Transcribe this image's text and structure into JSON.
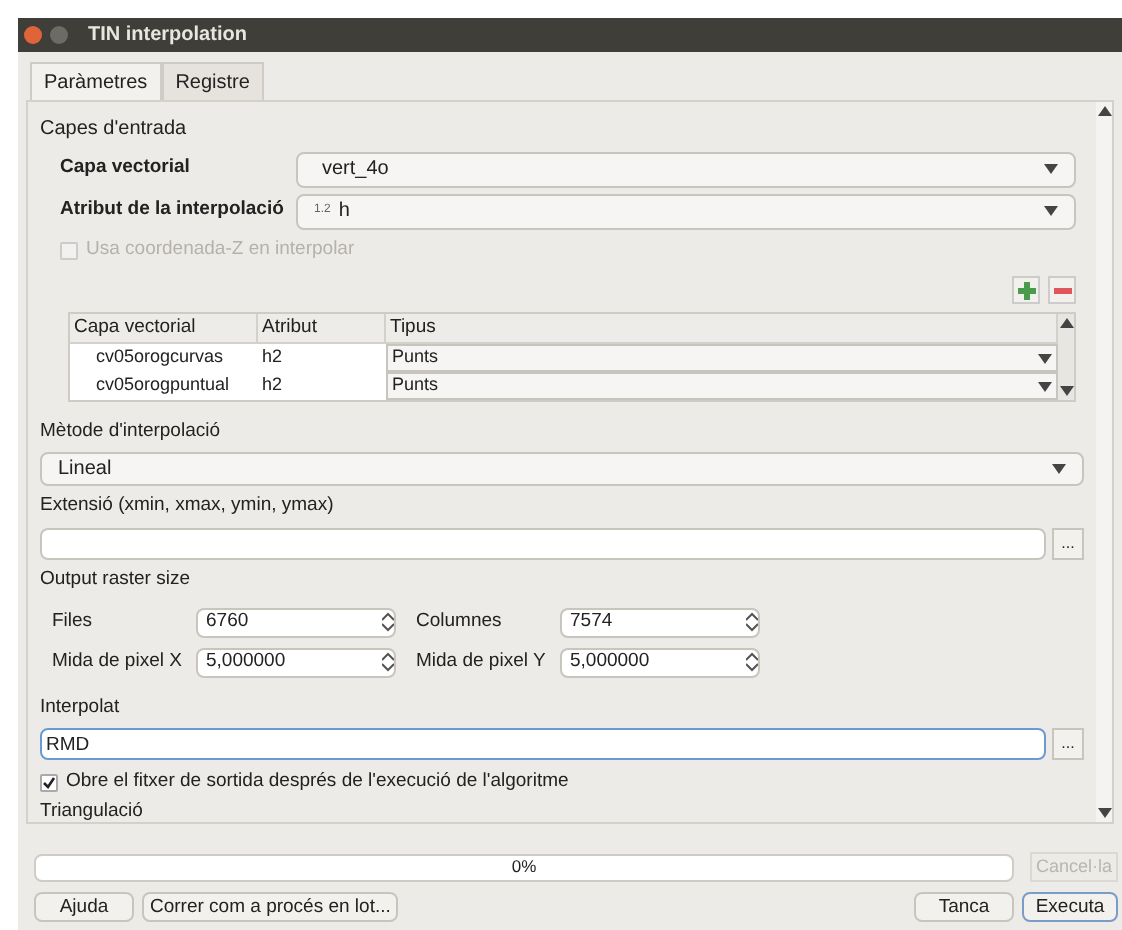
{
  "window": {
    "title": "TIN interpolation"
  },
  "tabs": [
    {
      "label": "Paràmetres",
      "selected": true
    },
    {
      "label": "Registre",
      "selected": false
    }
  ],
  "input_section": {
    "title": "Capes d'entrada",
    "vector_layer": {
      "label": "Capa vectorial",
      "value": "vert_4o"
    },
    "attribute": {
      "label": "Atribut de la interpolació",
      "type_badge": "1.2",
      "value": "h"
    },
    "use_z": {
      "label": "Usa coordenada-Z en interpolar",
      "checked": false,
      "disabled": true
    },
    "table": {
      "columns": [
        "Capa vectorial",
        "Atribut",
        "Tipus"
      ],
      "rows": [
        {
          "layer": "cv05orogcurvas",
          "attribute": "h2",
          "type": "Punts"
        },
        {
          "layer": "cv05orogpuntual",
          "attribute": "h2",
          "type": "Punts"
        }
      ]
    }
  },
  "method": {
    "label": "Mètode d'interpolació",
    "value": "Lineal"
  },
  "extent": {
    "label": "Extensió (xmin, xmax, ymin, ymax)",
    "browse": "..."
  },
  "raster_size": {
    "title": "Output raster size",
    "fields": [
      {
        "label": "Files",
        "value": "6760"
      },
      {
        "label": "Columnes",
        "value": "7574"
      },
      {
        "label": "Mida de pixel X",
        "value": "5,000000"
      },
      {
        "label": "Mida de pixel Y",
        "value": "5,000000"
      }
    ]
  },
  "output": {
    "label": "Interpolat",
    "value": "RMD",
    "browse": "..."
  },
  "open_output": {
    "label": "Obre el fitxer de sortida després de l'execució de l'algoritme",
    "checked": true
  },
  "triangulation": {
    "label": "Triangulació"
  },
  "progress": {
    "level": 0,
    "text": "0%",
    "cancel": "Cancel·la"
  },
  "buttons": {
    "help": "Ajuda",
    "batch": "Correr com a procés en lot...",
    "close": "Tanca",
    "run": "Executa"
  }
}
